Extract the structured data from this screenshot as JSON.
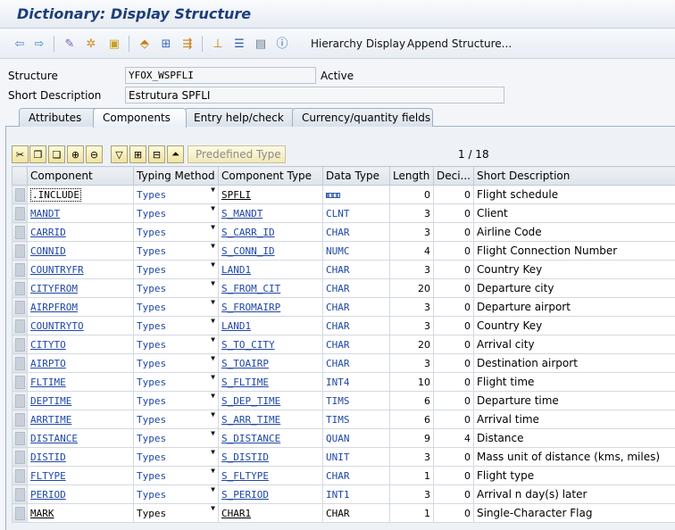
{
  "window": {
    "title": "Dictionary: Display Structure"
  },
  "toolbar": {
    "hierarchy_display": "Hierarchy Display",
    "append_structure": "Append Structure..."
  },
  "header": {
    "structure_label": "Structure",
    "structure_value": "YFOX_WSPFLI",
    "status": "Active",
    "short_desc_label": "Short Description",
    "short_desc_value": "Estrutura SPFLI"
  },
  "tabs": [
    "Attributes",
    "Components",
    "Entry help/check",
    "Currency/quantity fields"
  ],
  "active_tab": "Components",
  "grid_toolbar": {
    "predefined_type": "Predefined Type",
    "pager": "1 / 18"
  },
  "columns": [
    "Component",
    "Typing Method",
    "Component Type",
    "Data Type",
    "Length",
    "Deci...",
    "Short Description"
  ],
  "rows": [
    {
      "component": ".INCLUDE",
      "typing": "Types",
      "ctype": "SPFLI",
      "dtype": "",
      "length": "0",
      "decimals": "0",
      "desc": "Flight schedule"
    },
    {
      "component": "MANDT",
      "typing": "Types",
      "ctype": "S_MANDT",
      "dtype": "CLNT",
      "length": "3",
      "decimals": "0",
      "desc": "Client"
    },
    {
      "component": "CARRID",
      "typing": "Types",
      "ctype": "S_CARR_ID",
      "dtype": "CHAR",
      "length": "3",
      "decimals": "0",
      "desc": "Airline Code"
    },
    {
      "component": "CONNID",
      "typing": "Types",
      "ctype": "S_CONN_ID",
      "dtype": "NUMC",
      "length": "4",
      "decimals": "0",
      "desc": "Flight Connection Number"
    },
    {
      "component": "COUNTRYFR",
      "typing": "Types",
      "ctype": "LAND1",
      "dtype": "CHAR",
      "length": "3",
      "decimals": "0",
      "desc": "Country Key"
    },
    {
      "component": "CITYFROM",
      "typing": "Types",
      "ctype": "S_FROM_CIT",
      "dtype": "CHAR",
      "length": "20",
      "decimals": "0",
      "desc": "Departure city"
    },
    {
      "component": "AIRPFROM",
      "typing": "Types",
      "ctype": "S_FROMAIRP",
      "dtype": "CHAR",
      "length": "3",
      "decimals": "0",
      "desc": "Departure airport"
    },
    {
      "component": "COUNTRYTO",
      "typing": "Types",
      "ctype": "LAND1",
      "dtype": "CHAR",
      "length": "3",
      "decimals": "0",
      "desc": "Country Key"
    },
    {
      "component": "CITYTO",
      "typing": "Types",
      "ctype": "S_TO_CITY",
      "dtype": "CHAR",
      "length": "20",
      "decimals": "0",
      "desc": "Arrival city"
    },
    {
      "component": "AIRPTO",
      "typing": "Types",
      "ctype": "S_TOAIRP",
      "dtype": "CHAR",
      "length": "3",
      "decimals": "0",
      "desc": "Destination airport"
    },
    {
      "component": "FLTIME",
      "typing": "Types",
      "ctype": "S_FLTIME",
      "dtype": "INT4",
      "length": "10",
      "decimals": "0",
      "desc": "Flight time"
    },
    {
      "component": "DEPTIME",
      "typing": "Types",
      "ctype": "S_DEP_TIME",
      "dtype": "TIMS",
      "length": "6",
      "decimals": "0",
      "desc": "Departure time"
    },
    {
      "component": "ARRTIME",
      "typing": "Types",
      "ctype": "S_ARR_TIME",
      "dtype": "TIMS",
      "length": "6",
      "decimals": "0",
      "desc": "Arrival time"
    },
    {
      "component": "DISTANCE",
      "typing": "Types",
      "ctype": "S_DISTANCE",
      "dtype": "QUAN",
      "length": "9",
      "decimals": "4",
      "desc": "Distance"
    },
    {
      "component": "DISTID",
      "typing": "Types",
      "ctype": "S_DISTID",
      "dtype": "UNIT",
      "length": "3",
      "decimals": "0",
      "desc": "Mass unit of distance (kms, miles)"
    },
    {
      "component": "FLTYPE",
      "typing": "Types",
      "ctype": "S_FLTYPE",
      "dtype": "CHAR",
      "length": "1",
      "decimals": "0",
      "desc": "Flight type"
    },
    {
      "component": "PERIOD",
      "typing": "Types",
      "ctype": "S_PERIOD",
      "dtype": "INT1",
      "length": "3",
      "decimals": "0",
      "desc": "Arrival n day(s) later"
    },
    {
      "component": "MARK",
      "typing": "Types",
      "ctype": "CHAR1",
      "dtype": "CHAR",
      "length": "1",
      "decimals": "0",
      "desc": "Single-Character Flag"
    }
  ]
}
